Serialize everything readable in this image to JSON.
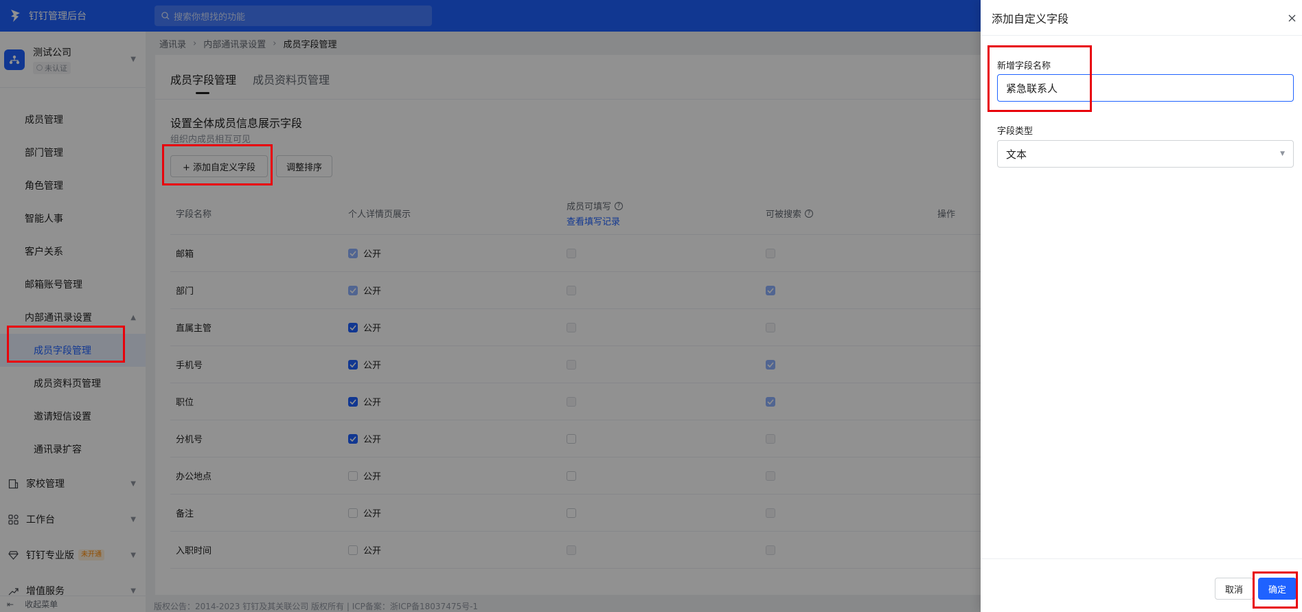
{
  "topbar": {
    "app_name": "钉钉管理后台",
    "search_placeholder": "搜索你想找的功能"
  },
  "company": {
    "name": "测试公司",
    "badge": "未认证"
  },
  "sidebar": {
    "items": [
      {
        "label": "成员管理"
      },
      {
        "label": "部门管理"
      },
      {
        "label": "角色管理"
      },
      {
        "label": "智能人事"
      },
      {
        "label": "客户关系"
      },
      {
        "label": "邮箱账号管理"
      },
      {
        "label": "内部通讯录设置"
      }
    ],
    "sub_items": [
      {
        "label": "成员字段管理"
      },
      {
        "label": "成员资料页管理"
      },
      {
        "label": "邀请短信设置"
      },
      {
        "label": "通讯录扩容"
      }
    ],
    "groups": [
      {
        "label": "家校管理"
      },
      {
        "label": "工作台"
      },
      {
        "label": "钉钉专业版",
        "badge": "未开通"
      },
      {
        "label": "增值服务"
      }
    ],
    "collapse_label": "收起菜单"
  },
  "breadcrumb": [
    "通讯录",
    "内部通讯录设置",
    "成员字段管理"
  ],
  "tabs": [
    "成员字段管理",
    "成员资料页管理"
  ],
  "section": {
    "title": "设置全体成员信息展示字段",
    "subtitle": "组织内成员相互可见"
  },
  "buttons": {
    "add_field": "+ 添加自定义字段",
    "sort": "调整排序"
  },
  "table": {
    "headers": {
      "name": "字段名称",
      "profile_display": "个人详情页展示",
      "member_editable": "成员可填写",
      "view_records": "查看填写记录",
      "searchable": "可被搜索",
      "actions": "操作"
    },
    "public_label": "公开",
    "rows": [
      {
        "name": "邮箱",
        "public": "checked-dim",
        "editable": "disabled",
        "searchable": "disabled"
      },
      {
        "name": "部门",
        "public": "checked-dim",
        "editable": "disabled",
        "searchable": "checked-dim"
      },
      {
        "name": "直属主管",
        "public": "checked",
        "editable": "disabled",
        "searchable": "disabled"
      },
      {
        "name": "手机号",
        "public": "checked",
        "editable": "disabled",
        "searchable": "checked-dim"
      },
      {
        "name": "职位",
        "public": "checked",
        "editable": "disabled",
        "searchable": "checked-dim"
      },
      {
        "name": "分机号",
        "public": "checked",
        "editable": "unchecked",
        "searchable": "disabled"
      },
      {
        "name": "办公地点",
        "public": "unchecked",
        "editable": "unchecked",
        "searchable": "disabled"
      },
      {
        "name": "备注",
        "public": "unchecked",
        "editable": "unchecked",
        "searchable": "disabled"
      },
      {
        "name": "入职时间",
        "public": "unchecked",
        "editable": "disabled",
        "searchable": "disabled"
      }
    ]
  },
  "footer": "版权公告：2014-2023 钉钉及其关联公司 版权所有 | ICP备案：浙ICP备18037475号-1",
  "drawer": {
    "title": "添加自定义字段",
    "name_label": "新增字段名称",
    "name_value": "紧急联系人",
    "type_label": "字段类型",
    "type_value": "文本",
    "cancel": "取消",
    "ok": "确定"
  },
  "colors": {
    "brand": "#1f62ff",
    "highlight": "#e8000b"
  }
}
